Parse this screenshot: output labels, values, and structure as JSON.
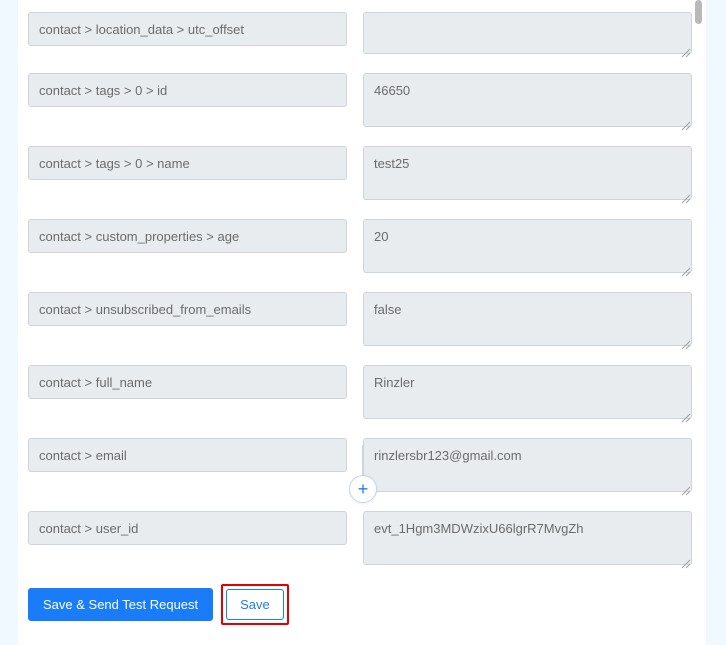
{
  "fields": [
    {
      "key": "contact > location_data > utc_offset",
      "value": "",
      "tall": true
    },
    {
      "key": "contact > tags > 0 > id",
      "value": "46650",
      "tall": false
    },
    {
      "key": "contact > tags > 0 > name",
      "value": "test25",
      "tall": false
    },
    {
      "key": "contact > custom_properties > age",
      "value": "20",
      "tall": false
    },
    {
      "key": "contact > unsubscribed_from_emails",
      "value": "false",
      "tall": false
    },
    {
      "key": "contact > full_name",
      "value": "Rinzler",
      "tall": false
    },
    {
      "key": "contact > email",
      "value": "rinzlersbr123@gmail.com",
      "tall": false
    },
    {
      "key": "contact > user_id",
      "value": "evt_1Hgm3MDWzixU66lgrR7MvgZh",
      "tall": false
    }
  ],
  "buttons": {
    "primary": "Save & Send Test Request",
    "secondary": "Save"
  },
  "add_icon": "+"
}
